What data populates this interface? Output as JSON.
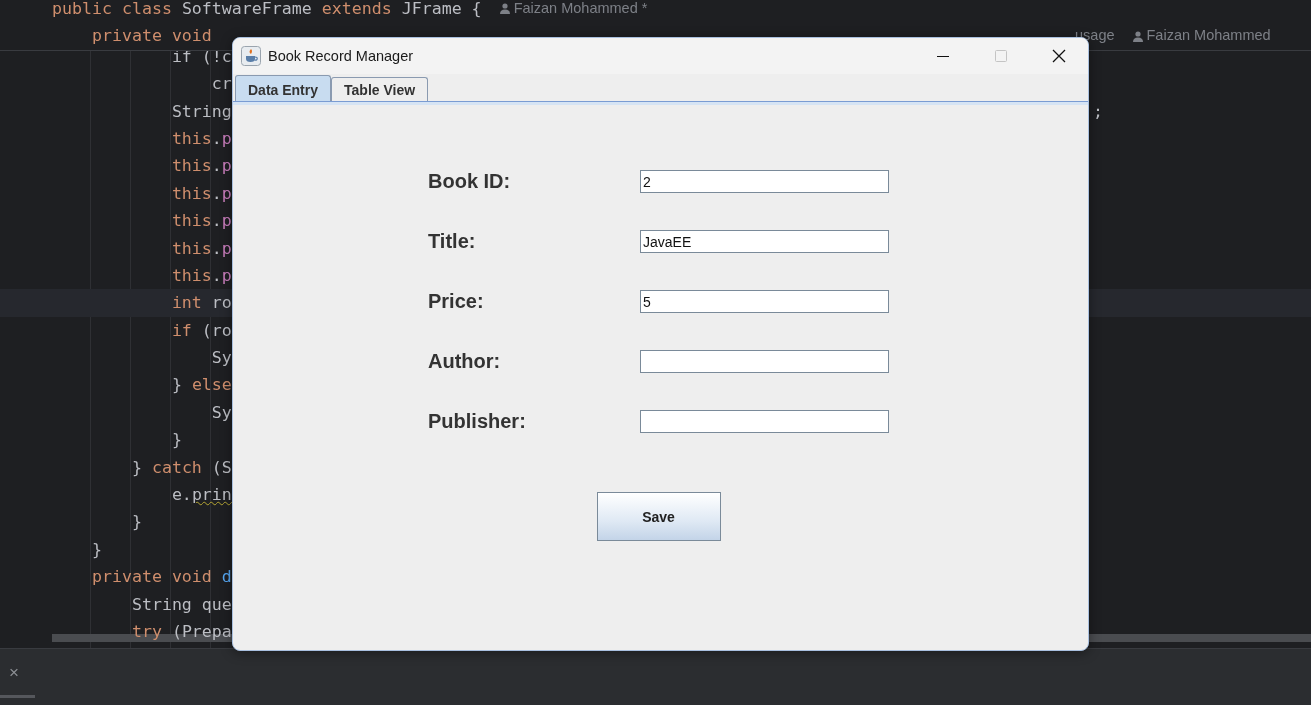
{
  "editor": {
    "sticky_lines": [
      {
        "segments": [
          {
            "text": "public class ",
            "kind": "keyword"
          },
          {
            "text": "SoftwareFrame ",
            "kind": "plain"
          },
          {
            "text": "extends ",
            "kind": "keyword"
          },
          {
            "text": "JFrame {",
            "kind": "plain"
          }
        ],
        "hints": [
          {
            "text": "Faizan Mohammed *",
            "kind": "author"
          }
        ]
      },
      {
        "segments": [
          {
            "text": "    private void",
            "kind": "keyword"
          }
        ],
        "far_hints": [
          {
            "text": "usage",
            "kind": "usage"
          },
          {
            "text": "Faizan Mohammed",
            "kind": "author"
          }
        ]
      }
    ],
    "lines": [
      {
        "segments": [
          {
            "text": "            if (!c",
            "kind": "plain"
          }
        ]
      },
      {
        "segments": [
          {
            "text": "                cr",
            "kind": "plain"
          }
        ]
      },
      {
        "segments": [
          {
            "text": "            String",
            "kind": "plain"
          }
        ],
        "tail": ";"
      },
      {
        "segments": [
          {
            "text": "            this",
            "kind": "keyword"
          },
          {
            "text": ".",
            "kind": "plain"
          },
          {
            "text": "p",
            "kind": "field"
          }
        ]
      },
      {
        "segments": [
          {
            "text": "            this",
            "kind": "keyword"
          },
          {
            "text": ".",
            "kind": "plain"
          },
          {
            "text": "p",
            "kind": "field"
          }
        ]
      },
      {
        "segments": [
          {
            "text": "            this",
            "kind": "keyword"
          },
          {
            "text": ".",
            "kind": "plain"
          },
          {
            "text": "p",
            "kind": "field"
          }
        ]
      },
      {
        "segments": [
          {
            "text": "            this",
            "kind": "keyword"
          },
          {
            "text": ".",
            "kind": "plain"
          },
          {
            "text": "p",
            "kind": "field"
          }
        ]
      },
      {
        "segments": [
          {
            "text": "            this",
            "kind": "keyword"
          },
          {
            "text": ".",
            "kind": "plain"
          },
          {
            "text": "p",
            "kind": "field"
          }
        ]
      },
      {
        "segments": [
          {
            "text": "            this",
            "kind": "keyword"
          },
          {
            "text": ".",
            "kind": "plain"
          },
          {
            "text": "p",
            "kind": "field"
          }
        ]
      },
      {
        "segments": [
          {
            "text": "            int ",
            "kind": "keyword"
          },
          {
            "text": "ro",
            "kind": "plain"
          }
        ],
        "current": true
      },
      {
        "segments": [
          {
            "text": "            if ",
            "kind": "keyword"
          },
          {
            "text": "(ro",
            "kind": "plain"
          }
        ]
      },
      {
        "segments": [
          {
            "text": "                Sy",
            "kind": "plain"
          }
        ]
      },
      {
        "segments": [
          {
            "text": "            } ",
            "kind": "plain"
          },
          {
            "text": "else",
            "kind": "keyword"
          }
        ]
      },
      {
        "segments": [
          {
            "text": "                Sy",
            "kind": "plain"
          }
        ]
      },
      {
        "segments": [
          {
            "text": "            }",
            "kind": "plain"
          }
        ]
      },
      {
        "segments": [
          {
            "text": "        } ",
            "kind": "plain"
          },
          {
            "text": "catch ",
            "kind": "keyword"
          },
          {
            "text": "(S",
            "kind": "plain"
          }
        ]
      },
      {
        "segments": [
          {
            "text": "            e.",
            "kind": "plain"
          },
          {
            "text": "prin",
            "kind": "warning"
          }
        ]
      },
      {
        "segments": [
          {
            "text": "        }",
            "kind": "plain"
          }
        ]
      },
      {
        "segments": [
          {
            "text": "    }",
            "kind": "plain"
          }
        ]
      },
      {
        "segments": [
          {
            "text": "    private void ",
            "kind": "keyword"
          },
          {
            "text": "d",
            "kind": "method"
          }
        ]
      },
      {
        "segments": [
          {
            "text": "        String que",
            "kind": "plain"
          }
        ]
      },
      {
        "segments": [
          {
            "text": "        try ",
            "kind": "keyword"
          },
          {
            "text": "(Prepa",
            "kind": "plain"
          }
        ]
      }
    ]
  },
  "bottom_panel": {
    "close": "×"
  },
  "window": {
    "title": "Book Record Manager",
    "maximize_enabled": false,
    "tabs": [
      {
        "label": "Data Entry",
        "selected": true
      },
      {
        "label": "Table View",
        "selected": false
      }
    ],
    "fields": [
      {
        "label": "Book ID:",
        "value": "2"
      },
      {
        "label": "Title:",
        "value": "JavaEE"
      },
      {
        "label": "Price:",
        "value": "5"
      },
      {
        "label": "Author:"
      },
      {
        "label": "Publisher:"
      }
    ],
    "button": "Save"
  }
}
